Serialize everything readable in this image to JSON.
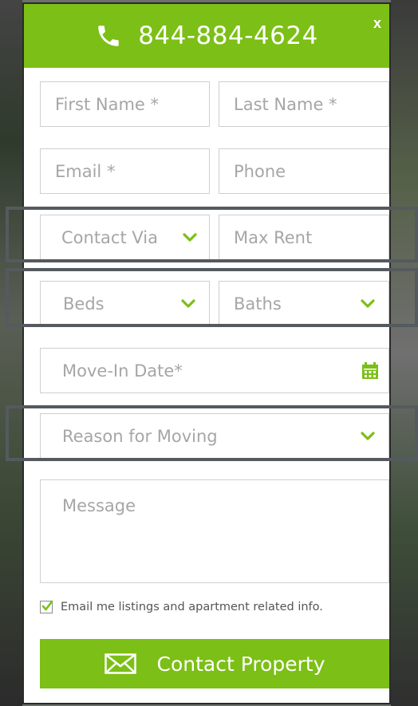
{
  "header": {
    "phone": "844-884-4624",
    "close_label": "x"
  },
  "form": {
    "first_name_placeholder": "First Name *",
    "last_name_placeholder": "Last Name *",
    "email_placeholder": "Email *",
    "phone_placeholder": "Phone",
    "contact_via_placeholder": "Contact Via",
    "max_rent_placeholder": "Max Rent",
    "beds_placeholder": "Beds",
    "baths_placeholder": "Baths",
    "move_in_placeholder": "Move-In Date*",
    "reason_placeholder": "Reason for Moving",
    "message_placeholder": "Message",
    "optin_label": "Email me listings and apartment related info.",
    "optin_checked": true,
    "submit_label": "Contact Property"
  },
  "colors": {
    "brand_green": "#7cbf17",
    "placeholder_gray": "#a6a6a6",
    "border_gray": "#cfcfcf",
    "highlight_frame": "#555a5e"
  },
  "icons": {
    "phone": "phone-icon",
    "close": "close-icon",
    "chevron": "chevron-down-icon",
    "calendar": "calendar-icon",
    "mail": "mail-icon",
    "check": "checkmark-icon"
  }
}
